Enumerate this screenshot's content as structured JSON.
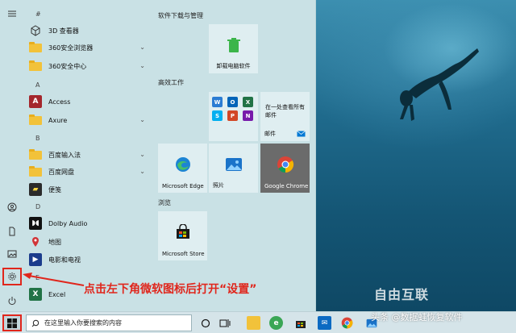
{
  "start_menu": {
    "app_list": {
      "hash_header": "#",
      "items": [
        {
          "label": "3D 查看器",
          "icon": "cube-icon"
        },
        {
          "label": "360安全浏览器",
          "icon": "folder-icon",
          "expandable": true
        },
        {
          "label": "360安全中心",
          "icon": "folder-icon",
          "expandable": true
        },
        {
          "group": "A"
        },
        {
          "label": "Access",
          "icon": "access-icon"
        },
        {
          "label": "Axure",
          "icon": "folder-icon",
          "expandable": true
        },
        {
          "group": "B"
        },
        {
          "label": "百度输入法",
          "icon": "folder-icon",
          "expandable": true
        },
        {
          "label": "百度网盘",
          "icon": "folder-icon",
          "expandable": true
        },
        {
          "label": "便笺",
          "icon": "sticky-notes-icon"
        },
        {
          "group": "D"
        },
        {
          "label": "Dolby Audio",
          "icon": "dolby-icon"
        },
        {
          "label": "地图",
          "icon": "maps-icon"
        },
        {
          "label": "电影和电视",
          "icon": "movies-tv-icon"
        },
        {
          "group": "E"
        },
        {
          "label": "Excel",
          "icon": "excel-icon"
        }
      ]
    },
    "tiles": {
      "groups": [
        {
          "title": "软件下载与管理"
        },
        {
          "title": "高效工作"
        },
        {
          "title": "浏览"
        }
      ],
      "uninstall": "卸载电脑软件",
      "mail_line1": "在一处查看所有",
      "mail_line2": "邮件",
      "mail": "邮件",
      "edge": "Microsoft Edge",
      "photos": "照片",
      "chrome": "Google Chrome",
      "store": "Microsoft Store"
    }
  },
  "annotation": "点击左下角微软图标后打开“设置”",
  "watermark": {
    "logo": "自由互联",
    "credit": "头条 @数据蛙恢复软件"
  },
  "taskbar": {
    "search_placeholder": "在这里输入你要搜索的内容"
  },
  "colors": {
    "annotation_red": "#e0261c",
    "menu_bg": "#c9e1e5",
    "tile_bg": "#dfeef1"
  }
}
